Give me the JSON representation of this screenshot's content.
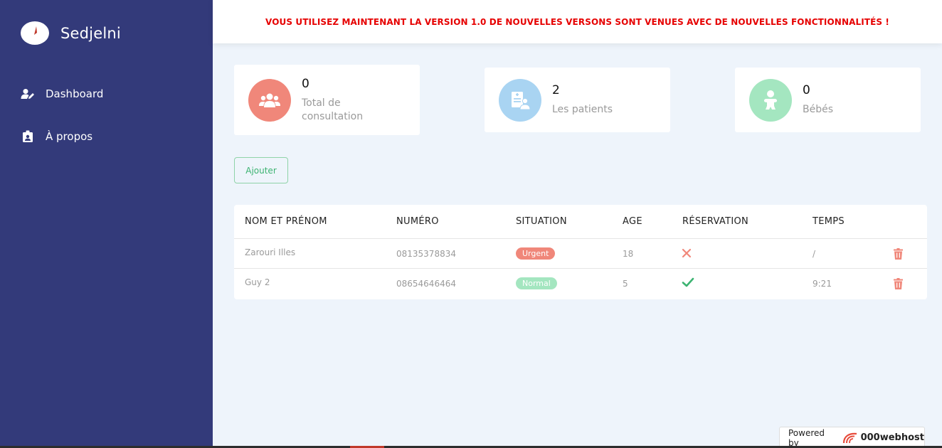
{
  "sidebar": {
    "brand": "Sedjelni",
    "items": [
      {
        "label": "Dashboard",
        "icon": "user-edit-icon"
      },
      {
        "label": "À propos",
        "icon": "id-badge-icon"
      }
    ]
  },
  "banner": {
    "message": "VOUS UTILISEZ MAINTENANT LA VERSION 1.0 DE NOUVELLES VERSONS SONT VENUES AVEC DE NOUVELLES FONCTIONNALITÉS !"
  },
  "stats": [
    {
      "value": "0",
      "label": "Total de consultation",
      "color": "#f0877a",
      "icon": "users-icon"
    },
    {
      "value": "2",
      "label": "Les patients",
      "color": "#a9d4f2",
      "icon": "patient-file-icon"
    },
    {
      "value": "0",
      "label": "Bébés",
      "color": "#a4e6c0",
      "icon": "baby-icon"
    }
  ],
  "actions": {
    "add_label": "Ajouter"
  },
  "table": {
    "headers": [
      "NOM ET PRÉNOM",
      "NUMÉRO",
      "SITUATION",
      "AGE",
      "RÉSERVATION",
      "TEMPS"
    ],
    "rows": [
      {
        "name": "Zarouri Illes",
        "number": "08135378834",
        "situation": "Urgent",
        "age": "18",
        "reservation": false,
        "time": "/"
      },
      {
        "name": "Guy 2",
        "number": "08654646464",
        "situation": "Normal",
        "age": "5",
        "reservation": true,
        "time": "9:21"
      }
    ]
  },
  "footer": {
    "powered_by": "Powered by",
    "host": "000webhost"
  },
  "colors": {
    "sidebar": "#333a7a",
    "banner_text": "#e60000",
    "urgent": "#f0877a",
    "normal": "#a4e6c0",
    "danger": "#f0877a",
    "success": "#3cb371"
  }
}
